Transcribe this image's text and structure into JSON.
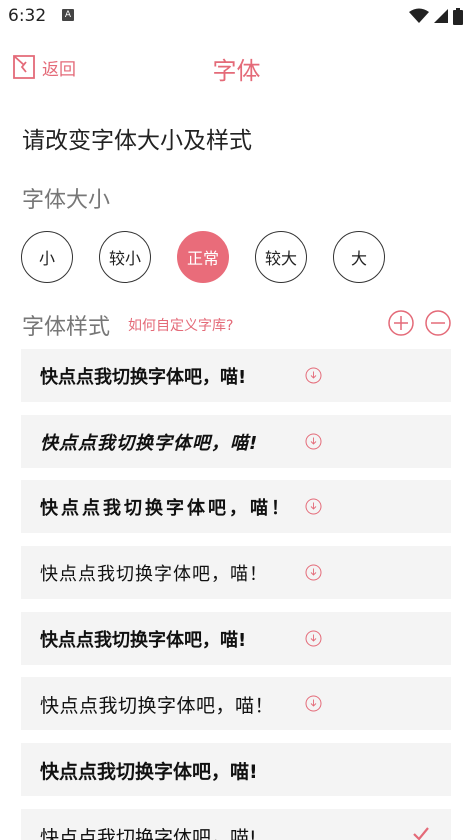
{
  "status": {
    "time": "6:32",
    "badge": "A"
  },
  "appbar": {
    "back_label": "返回",
    "title": "字体"
  },
  "heading": "请改变字体大小及样式",
  "size_section": {
    "label": "字体大小",
    "options": [
      "小",
      "较小",
      "正常",
      "较大",
      "大"
    ],
    "selected": "正常"
  },
  "style_section": {
    "label": "字体样式",
    "help_link": "如何自定义字库?"
  },
  "fonts": [
    {
      "sample": "快点点我切换字体吧，喵!",
      "weight": "bold",
      "spacing": "0px",
      "icon": "download-icon"
    },
    {
      "sample": "快点点我切换字体吧，喵!",
      "weight": "bold",
      "spacing": "1px",
      "icon": "download-icon",
      "style": "italic"
    },
    {
      "sample": "快点点我切换字体吧，喵！",
      "weight": "bold",
      "spacing": "3px",
      "icon": "download-icon"
    },
    {
      "sample": "快点点我切换字体吧，喵！",
      "weight": "normal",
      "spacing": "1px",
      "icon": "download-icon"
    },
    {
      "sample": "快点点我切换字体吧，喵!",
      "weight": "bold",
      "spacing": "0px",
      "icon": "download-icon"
    },
    {
      "sample": "快点点我切换字体吧，喵！",
      "weight": "normal",
      "spacing": "0.5px",
      "icon": "download-icon"
    },
    {
      "sample": "快点点我切换字体吧，喵!",
      "weight": "bold",
      "spacing": "0px",
      "icon": "none"
    },
    {
      "sample": "快点点我切换字体吧，喵!",
      "weight": "normal",
      "spacing": "0px",
      "icon": "check-icon"
    }
  ],
  "colors": {
    "accent": "#e46a78",
    "selected_fill": "#e96c7a",
    "row_bg": "#f4f4f4"
  }
}
